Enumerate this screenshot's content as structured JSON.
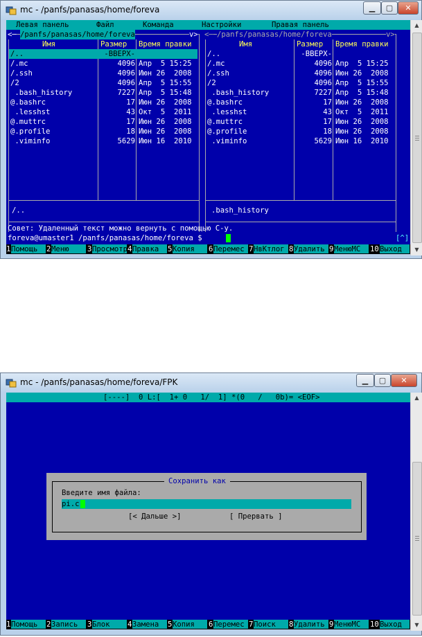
{
  "window1": {
    "title": "mc - /panfs/panasas/home/foreva",
    "menu": [
      "Левая панель",
      "Файл",
      "Команда",
      "Настройки",
      "Правая панель"
    ],
    "left_panel": {
      "path_prefix": "<─",
      "path": "/panfs/panasas/home/foreva",
      "path_suffix": "v>",
      "headers": [
        "Имя",
        "Размер",
        "Время правки"
      ],
      "rows": [
        {
          "name": "/..",
          "size": "-ВВЕРХ-",
          "time": ""
        },
        {
          "name": "/.mc",
          "size": "4096",
          "time": "Апр  5 15:25"
        },
        {
          "name": "/.ssh",
          "size": "4096",
          "time": "Июн 26  2008"
        },
        {
          "name": "/2",
          "size": "4096",
          "time": "Апр  5 15:55"
        },
        {
          "name": " .bash_history",
          "size": "7227",
          "time": "Апр  5 15:48"
        },
        {
          "name": "@.bashrc",
          "size": "17",
          "time": "Июн 26  2008"
        },
        {
          "name": " .lesshst",
          "size": "43",
          "time": "Окт  5  2011"
        },
        {
          "name": "@.muttrc",
          "size": "17",
          "time": "Июн 26  2008"
        },
        {
          "name": "@.profile",
          "size": "18",
          "time": "Июн 26  2008"
        },
        {
          "name": " .viminfo",
          "size": "5629",
          "time": "Июн 16  2010"
        }
      ],
      "status": "/.."
    },
    "right_panel": {
      "path_prefix": "<─",
      "path": "/panfs/panasas/home/foreva",
      "path_suffix": "v>",
      "headers": [
        "Имя",
        "Размер",
        "Время правки"
      ],
      "rows": [
        {
          "name": "/..",
          "size": "-ВВЕРХ-",
          "time": ""
        },
        {
          "name": "/.mc",
          "size": "4096",
          "time": "Апр  5 15:25"
        },
        {
          "name": "/.ssh",
          "size": "4096",
          "time": "Июн 26  2008"
        },
        {
          "name": "/2",
          "size": "4096",
          "time": "Апр  5 15:55"
        },
        {
          "name": " .bash_history",
          "size": "7227",
          "time": "Апр  5 15:48"
        },
        {
          "name": "@.bashrc",
          "size": "17",
          "time": "Июн 26  2008"
        },
        {
          "name": " .lesshst",
          "size": "43",
          "time": "Окт  5  2011"
        },
        {
          "name": "@.muttrc",
          "size": "17",
          "time": "Июн 26  2008"
        },
        {
          "name": "@.profile",
          "size": "18",
          "time": "Июн 26  2008"
        },
        {
          "name": " .viminfo",
          "size": "5629",
          "time": "Июн 16  2010"
        }
      ],
      "status": ".bash_history"
    },
    "hint": "Совет: Удаленный текст можно вернуть с помощью C-y.",
    "prompt": "foreva@umaster1 /panfs/panasas/home/foreva $",
    "prompt_marker": "[^]",
    "fkeys": [
      {
        "num": "1",
        "label": "Помощь"
      },
      {
        "num": "2",
        "label": "Меню"
      },
      {
        "num": "3",
        "label": "Просмотр"
      },
      {
        "num": "4",
        "label": "Правка"
      },
      {
        "num": "5",
        "label": "Копия"
      },
      {
        "num": "6",
        "label": "Перемес"
      },
      {
        "num": "7",
        "label": "НвКтлог"
      },
      {
        "num": "8",
        "label": "Удалить"
      },
      {
        "num": "9",
        "label": "МенюМС"
      },
      {
        "num": "10",
        "label": "Выход"
      }
    ]
  },
  "window2": {
    "title": "mc - /panfs/panasas/home/foreva/FPK",
    "status_line": "[----]  0 L:[  1+ 0   1/  1] *(0   /   0b)= <EOF>",
    "dialog": {
      "title": "Сохранить как",
      "prompt": "Введите имя файла:",
      "input_value": "pi.c",
      "ok_button": "[< Дальше >]",
      "cancel_button": "[ Прервать ]"
    },
    "fkeys": [
      {
        "num": "1",
        "label": "Помощь"
      },
      {
        "num": "2",
        "label": "Запись"
      },
      {
        "num": "3",
        "label": "Блок"
      },
      {
        "num": "4",
        "label": "Замена"
      },
      {
        "num": "5",
        "label": "Копия"
      },
      {
        "num": "6",
        "label": "Перемес"
      },
      {
        "num": "7",
        "label": "Поиск"
      },
      {
        "num": "8",
        "label": "Удалить"
      },
      {
        "num": "9",
        "label": "МенюМС"
      },
      {
        "num": "10",
        "label": "Выход"
      }
    ]
  },
  "colors": {
    "terminal_bg": "#0000aa",
    "cyan_bar": "#00aaaa",
    "selection": "#00aaaa",
    "dialog_bg": "#aaaaaa",
    "text_cyan": "#55ffff",
    "text_yellow": "#ffff55",
    "cursor": "#00ff00"
  },
  "icons": [
    "mc-app-icon",
    "minimize-icon",
    "maximize-icon",
    "close-icon",
    "scroll-up-icon",
    "scroll-down-icon"
  ]
}
